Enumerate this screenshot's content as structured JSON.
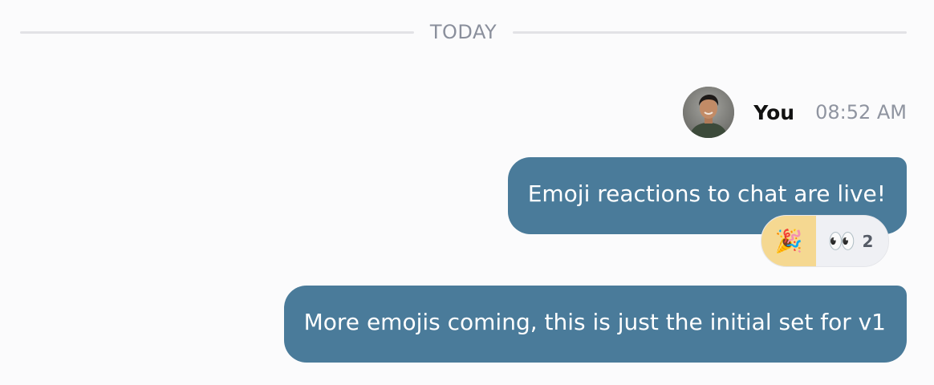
{
  "divider": {
    "label": "TODAY"
  },
  "message_group": {
    "sender": "You",
    "time": "08:52 AM",
    "avatar_icon": "user-avatar-photo",
    "messages": [
      {
        "text": "Emoji reactions to chat are live!",
        "reactions": [
          {
            "emoji": "🎉",
            "icon": "party-popper-icon",
            "count": "",
            "selected": true
          },
          {
            "emoji": "👀",
            "icon": "eyes-icon",
            "count": "2",
            "selected": false
          }
        ]
      },
      {
        "text": "More emojis coming, this is just the initial set for v1"
      }
    ]
  },
  "colors": {
    "bubble": "#4a7b9a",
    "reaction_selected": "#f5d891",
    "reaction_default": "#eff0f4",
    "divider": "#e2e2e6"
  }
}
